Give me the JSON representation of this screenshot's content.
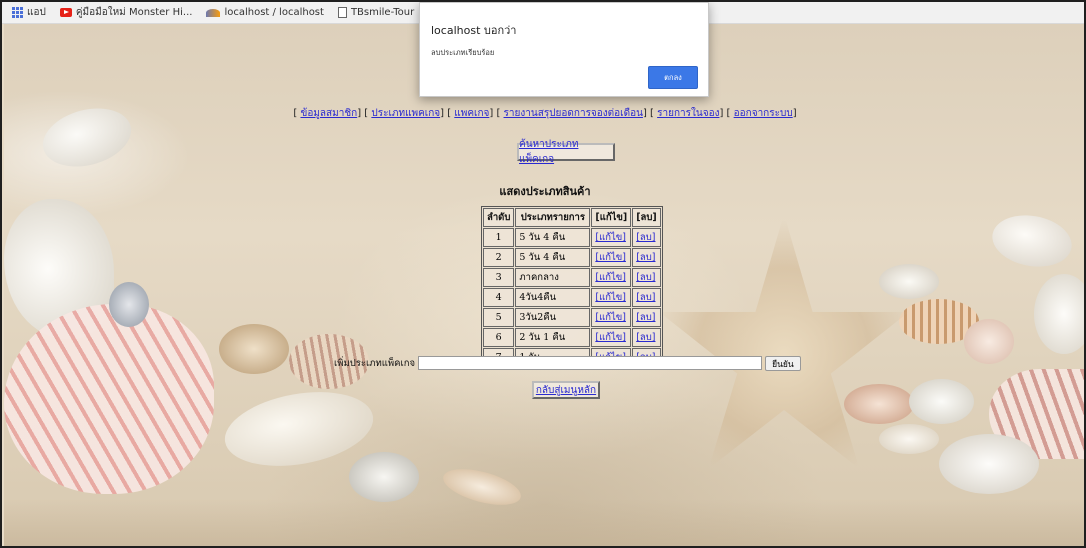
{
  "bookmarks": [
    {
      "label": "แอป",
      "icon": "apps-icon"
    },
    {
      "label": "คู่มือมือใหม่ Monster Hi...",
      "icon": "youtube-icon"
    },
    {
      "label": "localhost / localhost",
      "icon": "phpmyadmin-icon"
    },
    {
      "label": "TBsmile-Tour",
      "icon": "page-icon"
    }
  ],
  "alert": {
    "title": "localhost บอกว่า",
    "message": "ลบประเภทเรียบร้อย",
    "ok_label": "ตกลง",
    "ok_color": "#3b78e7"
  },
  "nav": {
    "items": [
      "ข้อมูลสมาชิก",
      "ประเภทแพคเกจ",
      "แพคเกจ",
      "รายงานสรุปยอดการจองต่อเดือน",
      "รายการในจอง",
      "ออกจากระบบ"
    ]
  },
  "search_button": "ค้นหาประเภทแพ็คเกจ",
  "section_title": "แสดงประเภทสินค้า",
  "table": {
    "headers": [
      "ลำดับ",
      "ประเภทรายการ",
      "[แก้ไข]",
      "[ลบ]"
    ],
    "edit_label": "[แก้ไข]",
    "delete_label": "[ลบ]",
    "rows": [
      {
        "no": "1",
        "name": "5 วัน 4 คืน"
      },
      {
        "no": "2",
        "name": "5 วัน 4 คืน"
      },
      {
        "no": "3",
        "name": "ภาคกลาง"
      },
      {
        "no": "4",
        "name": "4วัน4คืน"
      },
      {
        "no": "5",
        "name": "3วัน2คืน"
      },
      {
        "no": "6",
        "name": "2 วัน 1 คืน"
      },
      {
        "no": "7",
        "name": "1 วัน"
      }
    ]
  },
  "add_form": {
    "label": "เพิ่มประเภทแพ็คเกจ",
    "value": "",
    "confirm_label": "ยืนยัน"
  },
  "back_button": "กลับสู่เมนูหลัก",
  "link_color": "#2a2ad0"
}
